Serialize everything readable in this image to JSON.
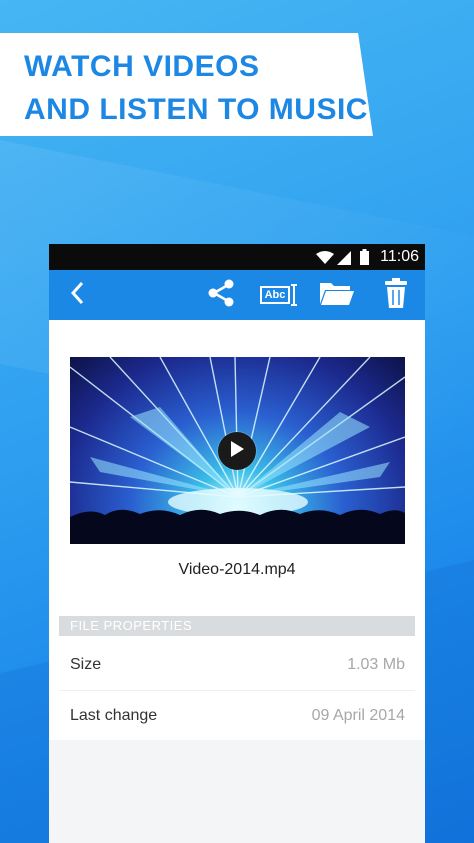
{
  "banner": {
    "line1": "WATCH VIDEOS",
    "line2": "AND LISTEN TO MUSIC"
  },
  "statusbar": {
    "time": "11:06",
    "icons": [
      "wifi-icon",
      "signal-icon",
      "battery-icon"
    ]
  },
  "toolbar": {
    "icons": [
      "back-arrow-icon",
      "share-icon",
      "rename-icon",
      "folder-icon",
      "trash-icon"
    ],
    "rename_icon_text": "Abc"
  },
  "video": {
    "filename": "Video-2014.mp4"
  },
  "properties": {
    "header": "FILE PROPERTIES",
    "rows": [
      {
        "label": "Size",
        "value": "1.03 Mb"
      },
      {
        "label": "Last change",
        "value": "09 April 2014"
      }
    ]
  },
  "colors": {
    "accent": "#1c88e6",
    "banner_text": "#1d87e4",
    "section_header_bg": "#d9dcdf"
  }
}
